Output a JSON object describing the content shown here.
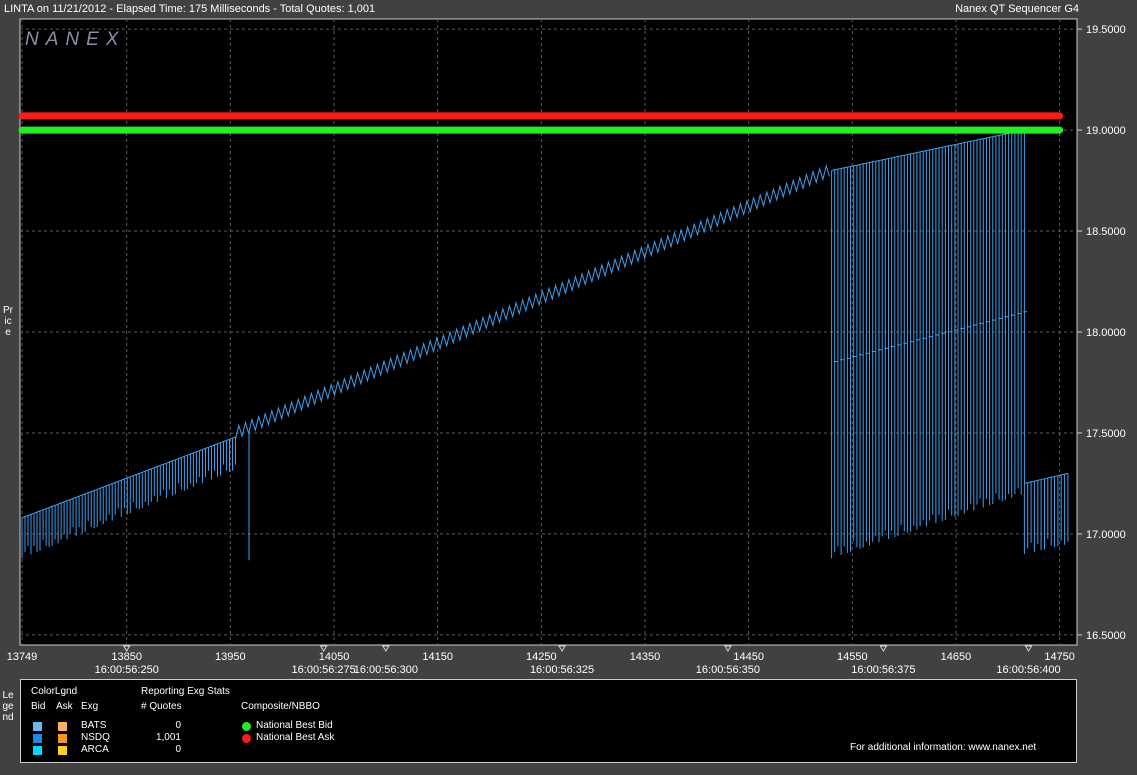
{
  "header": {
    "left": "LINTA on 11/21/2012  -  Elapsed Time: 175 Milliseconds  -  Total Quotes: 1,001",
    "right": "Nanex QT Sequencer G4"
  },
  "watermark": "NANEX",
  "side_labels": {
    "price": "Price",
    "legend": "Legend"
  },
  "chart_data": {
    "type": "line",
    "title": "",
    "ylabel": "Price",
    "ylim": [
      16.45,
      19.55
    ],
    "xlim": [
      13749,
      14760
    ],
    "y_ticks": [
      "19.5000",
      "19.0000",
      "18.5000",
      "18.0000",
      "17.5000",
      "17.0000",
      "16.5000"
    ],
    "y_tick_values": [
      19.5,
      19.0,
      18.5,
      18.0,
      17.5,
      17.0,
      16.5
    ],
    "x_ticks": [
      "13749",
      "13850",
      "13950",
      "14050",
      "14150",
      "14250",
      "14350",
      "14450",
      "14550",
      "14650",
      "14750"
    ],
    "x_tick_values": [
      13749,
      13850,
      13950,
      14050,
      14150,
      14250,
      14350,
      14450,
      14550,
      14650,
      14750
    ],
    "time_ticks": [
      "16:00:56:250",
      "16:00:56:275",
      "16:00:56:300",
      "16:00:56:325",
      "16:00:56:350",
      "16:00:56:375",
      "16:00:56:400"
    ],
    "time_tick_values": [
      13850,
      14040,
      14100,
      14270,
      14430,
      14580,
      14720
    ],
    "grid": true,
    "series": [
      {
        "name": "National Best Ask",
        "color": "#ff1a1a",
        "values": [
          [
            13749,
            19.07
          ],
          [
            14750,
            19.07
          ]
        ]
      },
      {
        "name": "National Best Bid",
        "color": "#22ee22",
        "values": [
          [
            13749,
            19.0
          ],
          [
            14750,
            19.0
          ]
        ]
      },
      {
        "name": "NSDQ",
        "color": "#3aa0f0",
        "segments": [
          {
            "kind": "band",
            "x0": 13749,
            "x1": 13955,
            "hi0": 17.08,
            "hi1": 17.48,
            "lo0": 16.88,
            "lo1": 17.32,
            "n": 72
          },
          {
            "kind": "drop",
            "x": 13968,
            "from": 17.5,
            "to": 16.87
          },
          {
            "kind": "ramp",
            "x0": 13955,
            "x1": 14528,
            "y0": 17.5,
            "y1": 18.8,
            "amp": 0.03,
            "n": 180
          },
          {
            "kind": "band",
            "x0": 14530,
            "x1": 14716,
            "hi0": 18.8,
            "hi1": 19.0,
            "lo0": 16.88,
            "lo1": 17.2,
            "n": 62,
            "mid0": 17.85,
            "mid1": 18.1
          },
          {
            "kind": "band",
            "x0": 14716,
            "x1": 14758,
            "hi0": 17.25,
            "hi1": 17.3,
            "lo0": 16.9,
            "lo1": 16.95,
            "n": 14
          }
        ]
      }
    ]
  },
  "legend": {
    "col_headers": {
      "colorlgnd": "ColorLgnd",
      "bid": "Bid",
      "ask": "Ask",
      "exg": "Exg"
    },
    "stats_header": "Reporting Exg Stats",
    "quotes_header": "# Quotes",
    "composite_header": "Composite/NBBO",
    "exchanges": [
      {
        "name": "BATS",
        "quotes": "0",
        "bid_color": "#6fb8ee",
        "ask_color": "#f5b36a"
      },
      {
        "name": "NSDQ",
        "quotes": "1,001",
        "bid_color": "#1e88e5",
        "ask_color": "#f39a1e"
      },
      {
        "name": "ARCA",
        "quotes": "0",
        "bid_color": "#00d8ff",
        "ask_color": "#ffd21a"
      }
    ],
    "nbbo": [
      {
        "label": "National Best Bid",
        "color": "#22ee22"
      },
      {
        "label": "National Best Ask",
        "color": "#ff1a1a"
      }
    ],
    "footer": "For additional information: www.nanex.net"
  }
}
